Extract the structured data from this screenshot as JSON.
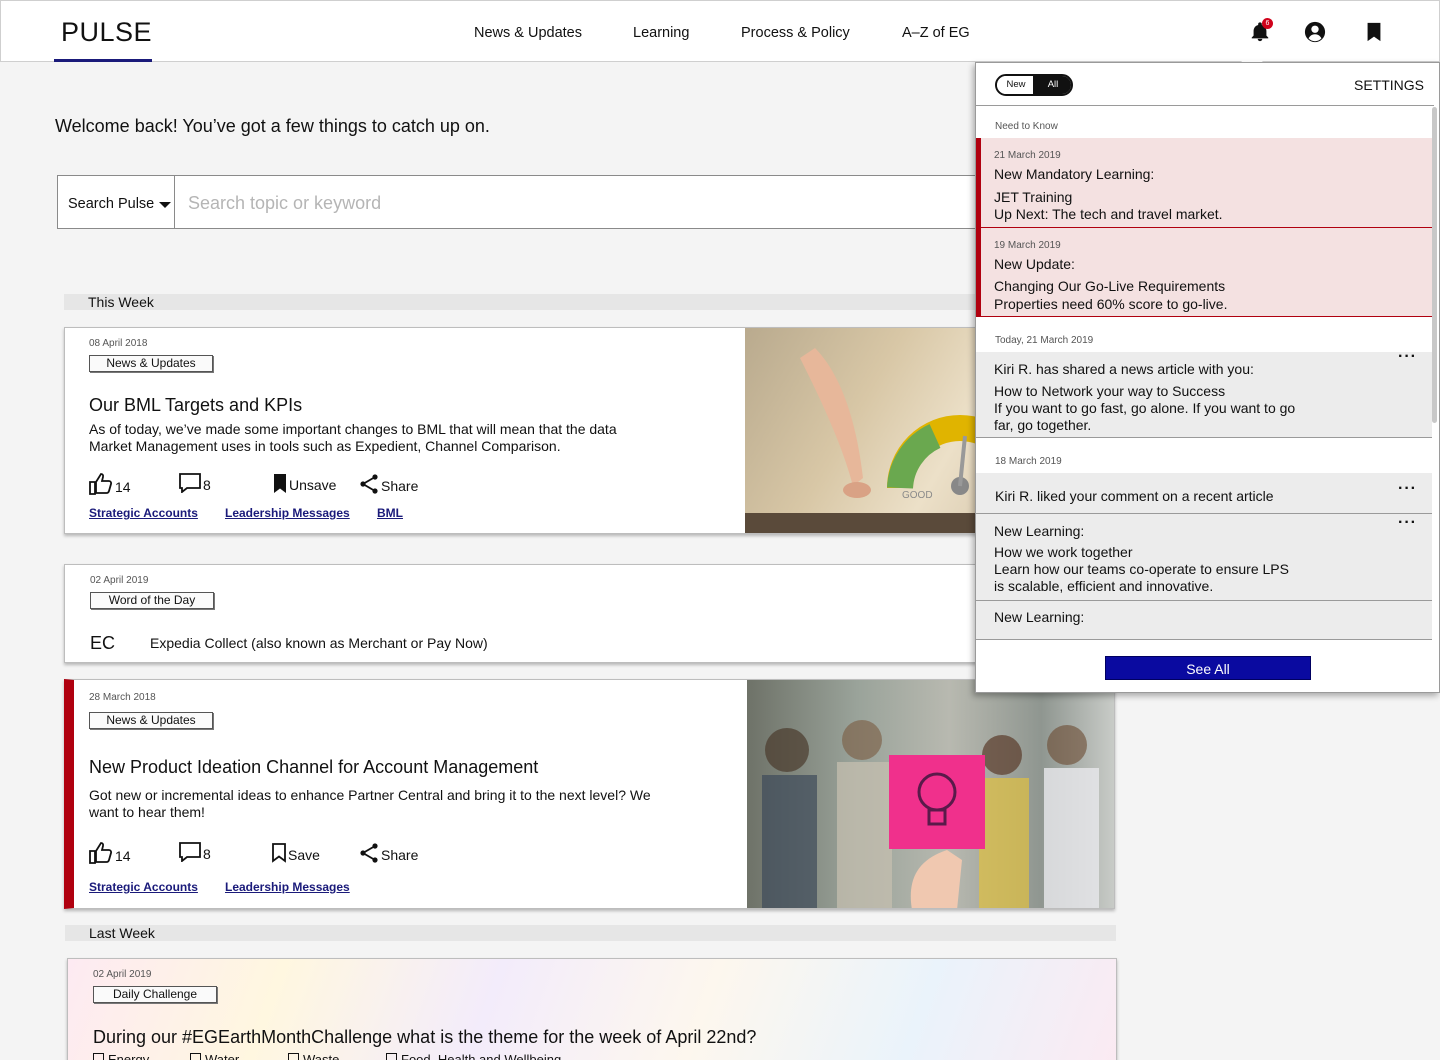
{
  "header": {
    "logo": "PULSE",
    "nav": [
      "News & Updates",
      "Learning",
      "Process & Policy",
      "A–Z of EG"
    ],
    "notification_count": "6",
    "icons": [
      "bell-icon",
      "account-icon",
      "bookmark-icon"
    ]
  },
  "welcome": "Welcome back! You’ve got a few things to catch up on.",
  "search": {
    "scope": "Search Pulse",
    "placeholder": "Search topic or keyword"
  },
  "sections": {
    "this_week": "This Week",
    "last_week": "Last Week"
  },
  "cards": [
    {
      "date": "08 April 2018",
      "tag": "News & Updates",
      "title": "Our BML Targets and KPIs",
      "desc": "As of today, we’ve made some important changes to BML that will mean that the data Market Management uses in tools such as Expedient, Channel Comparison.",
      "likes": "14",
      "comments": "8",
      "save_label": "Unsave",
      "share_label": "Share",
      "topics": [
        "Strategic Accounts",
        "Leadership Messages",
        "BML"
      ],
      "image_caption": "GOOD"
    },
    {
      "date": "02 April 2019",
      "tag": "Word of the Day",
      "term": "EC",
      "definition": "Expedia Collect (also known as Merchant or Pay Now)"
    },
    {
      "date": "28 March 2018",
      "tag": "News & Updates",
      "title": "New Product Ideation Channel for Account Management",
      "desc": "Got new or incremental ideas to enhance Partner Central and bring it to the next level? We want to hear them!",
      "likes": "14",
      "comments": "8",
      "save_label": "Save",
      "share_label": "Share",
      "topics": [
        "Strategic Accounts",
        "Leadership Messages"
      ]
    },
    {
      "date": "02 April 2019",
      "tag": "Daily Challenge",
      "question": "During our #EGEarthMonthChallenge what is the theme for the week of April 22nd?",
      "options": [
        "Energy",
        "Water",
        "Waste",
        "Food, Health and Wellbeing"
      ]
    }
  ],
  "notifications": {
    "toggle_new": "New",
    "toggle_all": "All",
    "settings": "SETTINGS",
    "need_to_know": "Need to Know",
    "today": "Today, 21 March 2019",
    "march18": "18 March 2019",
    "items": [
      {
        "date": "21 March 2019",
        "line1": "New Mandatory Learning:",
        "line2": "JET Training",
        "line3": "Up Next: The tech and travel market."
      },
      {
        "date": "19 March 2019",
        "line1": "New Update:",
        "line2": "Changing Our Go-Live Requirements",
        "line3": "Properties need 60% score to go-live."
      },
      {
        "line1": "Kiri R. has shared a news article with you:",
        "line2": "How to Network your way to Success",
        "line3": "If you want to go fast, go alone. If you want to go",
        "line4": "far, go together."
      },
      {
        "line1": "Kiri R. liked your comment on a recent article"
      },
      {
        "line1": "New Learning:",
        "line2": "How we work together",
        "line3": "Learn how our teams co-operate to ensure LPS",
        "line4": "is scalable, efficient and innovative."
      },
      {
        "line1": "New Learning:"
      }
    ],
    "see_all": "See All"
  },
  "colors": {
    "accent_red": "#b0000f",
    "brand_navy": "#1a1a7a",
    "button_blue": "#0a0aa0",
    "alert_bg": "#f4e1e1"
  }
}
